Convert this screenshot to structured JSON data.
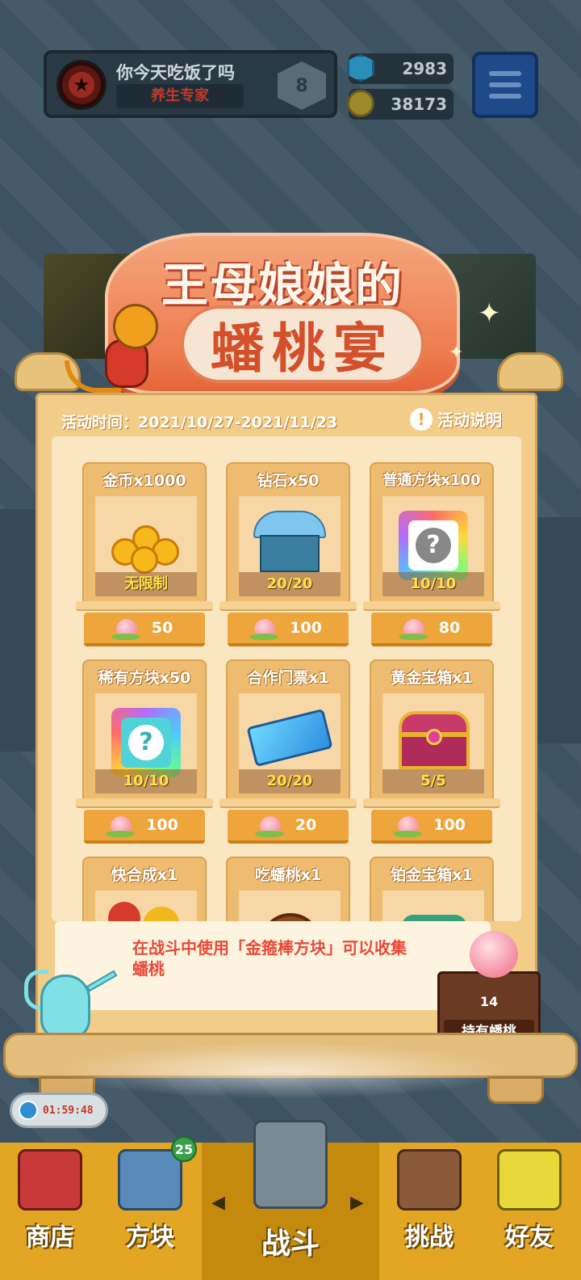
{
  "player": {
    "name": "你今天吃饭了吗",
    "title": "养生专家",
    "rank": "8"
  },
  "currencies": {
    "gems": "2983",
    "coins": "38173"
  },
  "event": {
    "title_line1": "王母娘娘的",
    "title_line2": "蟠桃宴",
    "time_label": "活动时间：2021/10/27-2021/11/23",
    "info_label": "活动说明",
    "info_icon": "!"
  },
  "items": [
    {
      "name": "金币x1000",
      "stock": "无限制",
      "price": "50"
    },
    {
      "name": "钻石x50",
      "stock": "20/20",
      "price": "100"
    },
    {
      "name": "普通方块x100",
      "stock": "10/10",
      "price": "80"
    },
    {
      "name": "稀有方块x50",
      "stock": "10/10",
      "price": "100"
    },
    {
      "name": "合作门票x1",
      "stock": "20/20",
      "price": "20"
    },
    {
      "name": "黄金宝箱x1",
      "stock": "5/5",
      "price": "100"
    },
    {
      "name": "快合成x1"
    },
    {
      "name": "吃蟠桃x1"
    },
    {
      "name": "铂金宝箱x1"
    }
  ],
  "tip": {
    "text": "在战斗中使用「金箍棒方块」可以收集蟠桃"
  },
  "peach_holder": {
    "count": "14",
    "label": "持有蟠桃"
  },
  "timer": "01:59:48",
  "nav": {
    "shop": "商店",
    "blocks": "方块",
    "blocks_badge": "25",
    "battle": "战斗",
    "challenge": "挑战",
    "friends": "好友",
    "prev_arrow": "◀",
    "next_arrow": "▶"
  },
  "question_mark": "?"
}
